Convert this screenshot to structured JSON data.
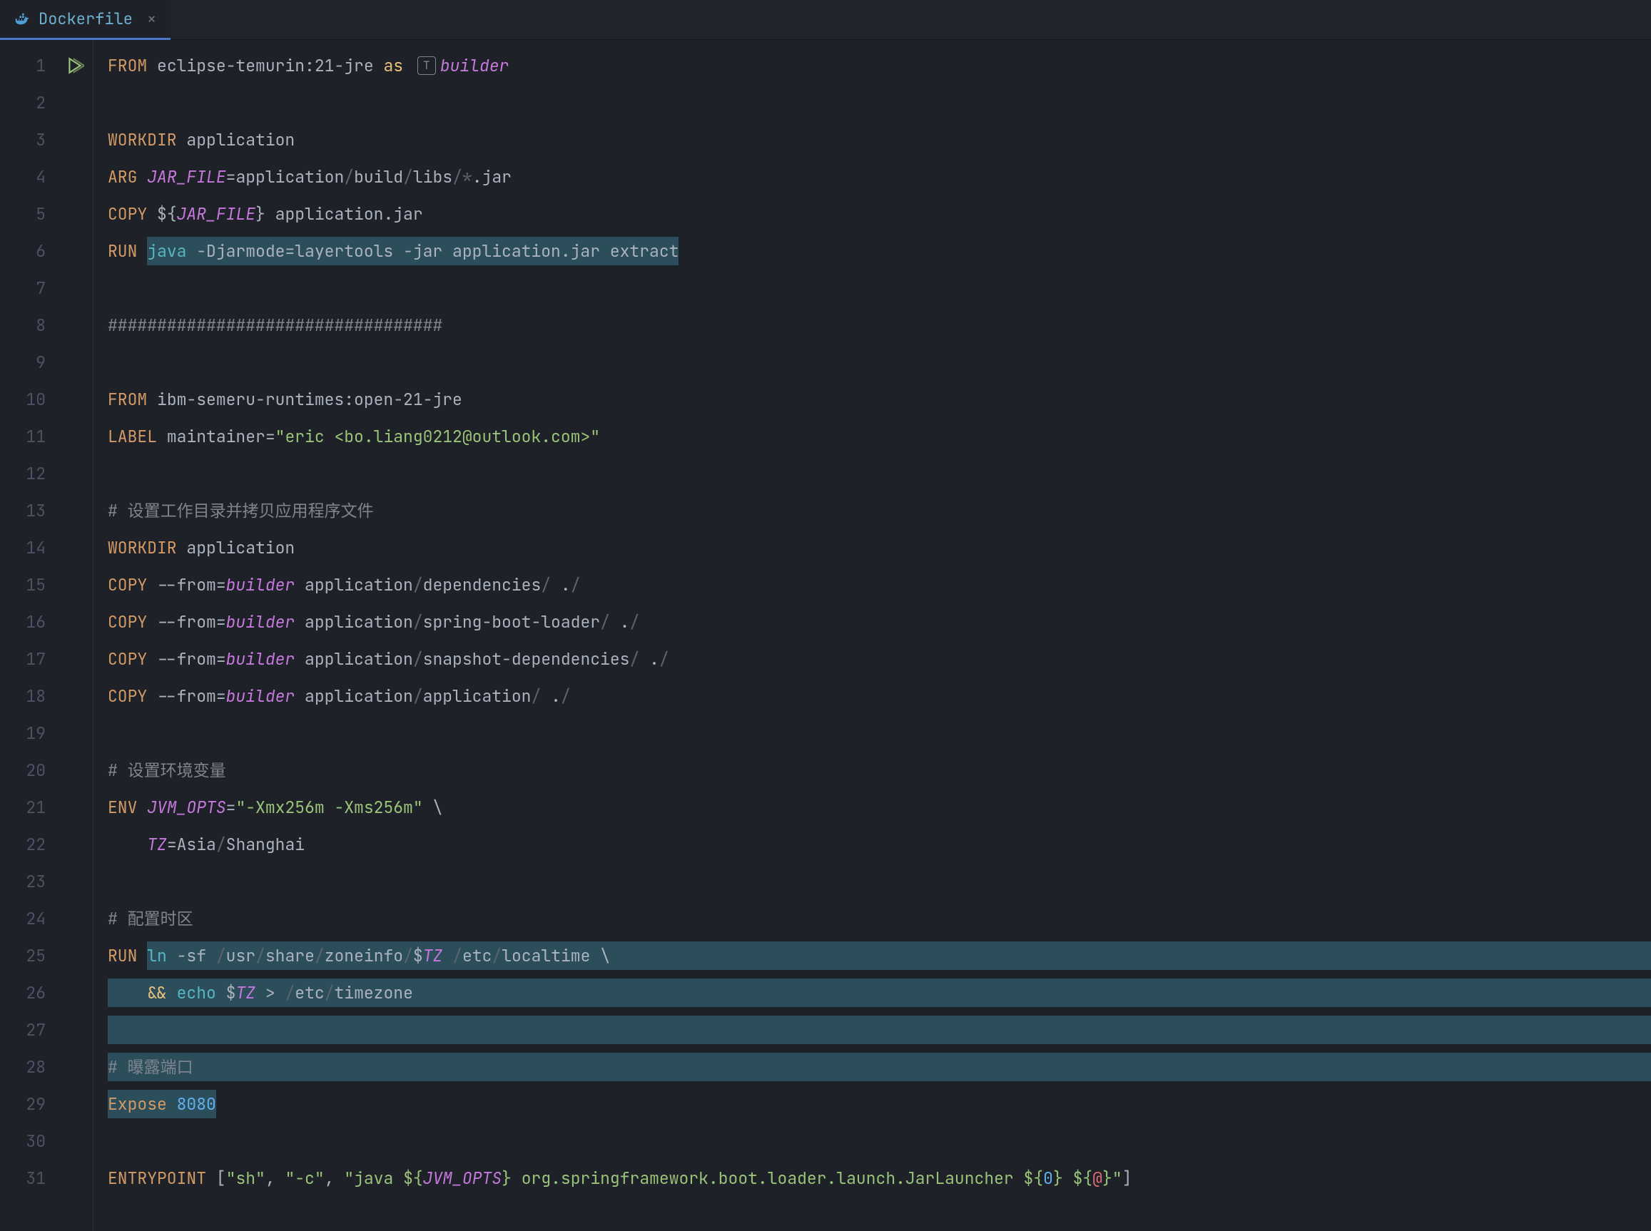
{
  "tab": {
    "filename": "Dockerfile",
    "close": "×"
  },
  "gutter": {
    "lines": [
      "1",
      "2",
      "3",
      "4",
      "5",
      "6",
      "7",
      "8",
      "9",
      "10",
      "11",
      "12",
      "13",
      "14",
      "15",
      "16",
      "17",
      "18",
      "19",
      "20",
      "21",
      "22",
      "23",
      "24",
      "25",
      "26",
      "27",
      "28",
      "29",
      "30",
      "31"
    ]
  },
  "code": {
    "l1": {
      "from": "FROM",
      "image": "eclipse-temurin:21-jre",
      "as": "as",
      "builder": "builder"
    },
    "l3": {
      "workdir": "WORKDIR",
      "path": "application"
    },
    "l4": {
      "arg": "ARG",
      "var": "JAR_FILE",
      "eq": "=",
      "path": "application",
      "slash1": "/",
      "build": "build",
      "slash2": "/",
      "libs": "libs",
      "slash3": "/",
      "star": "*",
      "ext": ".jar"
    },
    "l5": {
      "copy": "COPY",
      "dollar": "$",
      "brace1": "{",
      "var": "JAR_FILE",
      "brace2": "}",
      "dest": " application.jar"
    },
    "l6": {
      "run": "RUN",
      "java": "java",
      "args": " -Djarmode=layertools -jar application.jar extract"
    },
    "l8": {
      "hash": "##################################"
    },
    "l10": {
      "from": "FROM",
      "image": "ibm-semeru-runtimes:open-21-jre"
    },
    "l11": {
      "label": "LABEL",
      "key": "maintainer=",
      "val": "\"eric <bo.liang0212@outlook.com>\""
    },
    "l13": {
      "comment": "# 设置工作目录并拷贝应用程序文件"
    },
    "l14": {
      "workdir": "WORKDIR",
      "path": "application"
    },
    "l15": {
      "copy": "COPY",
      "from": "--from=",
      "builder": "builder",
      "src": " application",
      "slash": "/",
      "dep": "dependencies",
      "slash2": "/",
      "dest": " .",
      "slash3": "/"
    },
    "l16": {
      "copy": "COPY",
      "from": "--from=",
      "builder": "builder",
      "src": " application",
      "slash": "/",
      "dep": "spring-boot-loader",
      "slash2": "/",
      "dest": " .",
      "slash3": "/"
    },
    "l17": {
      "copy": "COPY",
      "from": "--from=",
      "builder": "builder",
      "src": " application",
      "slash": "/",
      "dep": "snapshot-dependencies",
      "slash2": "/",
      "dest": " .",
      "slash3": "/"
    },
    "l18": {
      "copy": "COPY",
      "from": "--from=",
      "builder": "builder",
      "src": " application",
      "slash": "/",
      "dep": "application",
      "slash2": "/",
      "dest": " .",
      "slash3": "/"
    },
    "l20": {
      "comment": "# 设置环境变量"
    },
    "l21": {
      "env": "ENV",
      "var": "JVM_OPTS",
      "eq": "=",
      "val": "\"-Xmx256m -Xms256m\"",
      "bs": " \\"
    },
    "l22": {
      "indent": "    ",
      "var": "TZ",
      "eq": "=",
      "asia": "Asia",
      "slash": "/",
      "shanghai": "Shanghai"
    },
    "l24": {
      "comment": "# 配置时区"
    },
    "l25": {
      "run": "RUN",
      "ln": "ln",
      " -sf ": " -sf ",
      "slash1": "/",
      "usr": "usr",
      "slash2": "/",
      "share": "share",
      "slash3": "/",
      "zone": "zoneinfo",
      "slash4": "/",
      "dollar": "$",
      "tz": "TZ",
      "space": " ",
      "slash5": "/",
      "etc": "etc",
      "slash6": "/",
      "localtime": "localtime",
      "bs": " \\"
    },
    "l26": {
      "indent": "    ",
      "and": "&&",
      "space": " ",
      "echo": "echo",
      " $": " $",
      "tz": "TZ",
      "gt": " > ",
      "slash": "/",
      "etc": "etc",
      "slash2": "/",
      "timezone": "timezone"
    },
    "l28": {
      "comment": "# 曝露端口"
    },
    "l29": {
      "expose": "Expose",
      "port": "8080"
    },
    "l31": {
      "entry": "ENTRYPOINT",
      "sp": " ",
      "br1": "[",
      "sh": "\"sh\"",
      "c1": ", ",
      "dashc": "\"-c\"",
      "c2": ", ",
      "q1": "\"java ",
      "d1": "$",
      "b1": "{",
      "jvm": "JVM_OPTS",
      "b2": "}",
      "mid": " org.springframework.boot.loader.launch.JarLauncher ",
      "d2": "$",
      "b3": "{",
      "zero": "0",
      "b4": "}",
      "sp2": " ",
      "d3": "$",
      "b5": "{",
      "at": "@",
      "b6": "}",
      "q2": "\"",
      "br2": "]"
    }
  }
}
